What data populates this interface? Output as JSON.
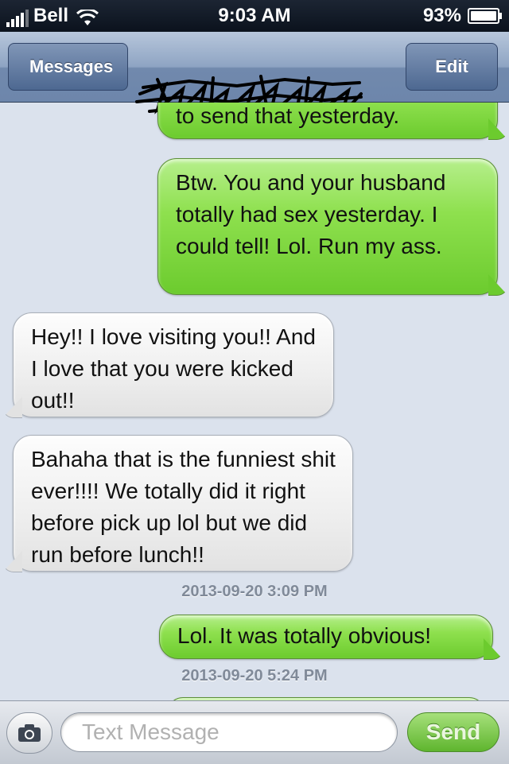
{
  "status_bar": {
    "carrier": "Bell",
    "time": "9:03 AM",
    "battery": "93%"
  },
  "nav": {
    "back_label": "Messages",
    "edit_label": "Edit"
  },
  "messages": [
    {
      "dir": "out",
      "text": "to send that yesterday."
    },
    {
      "dir": "out",
      "text": "Btw. You and your husband totally had sex yesterday. I could tell! Lol. Run my ass."
    },
    {
      "dir": "in",
      "text": "Hey!!  I love visiting you!! And I love that you were kicked out!!"
    },
    {
      "dir": "in",
      "text": "Bahaha that is the funniest shit ever!!!! We totally did it right before pick up lol but we did run before lunch!!"
    },
    {
      "dir": "out",
      "text": "Lol. It was totally obvious!"
    }
  ],
  "timestamps": [
    "2013-09-20 3:09 PM",
    "2013-09-20 5:24 PM"
  ],
  "composer": {
    "placeholder": "Text Message",
    "send_label": "Send"
  },
  "colors": {
    "outgoing_bubble": "#8ee04e",
    "incoming_bubble": "#eeeeee",
    "nav_bar": "#7189ad",
    "background": "#dbe2ed"
  },
  "icons": [
    "wifi-icon",
    "signal-icon",
    "battery-icon",
    "camera-icon"
  ]
}
